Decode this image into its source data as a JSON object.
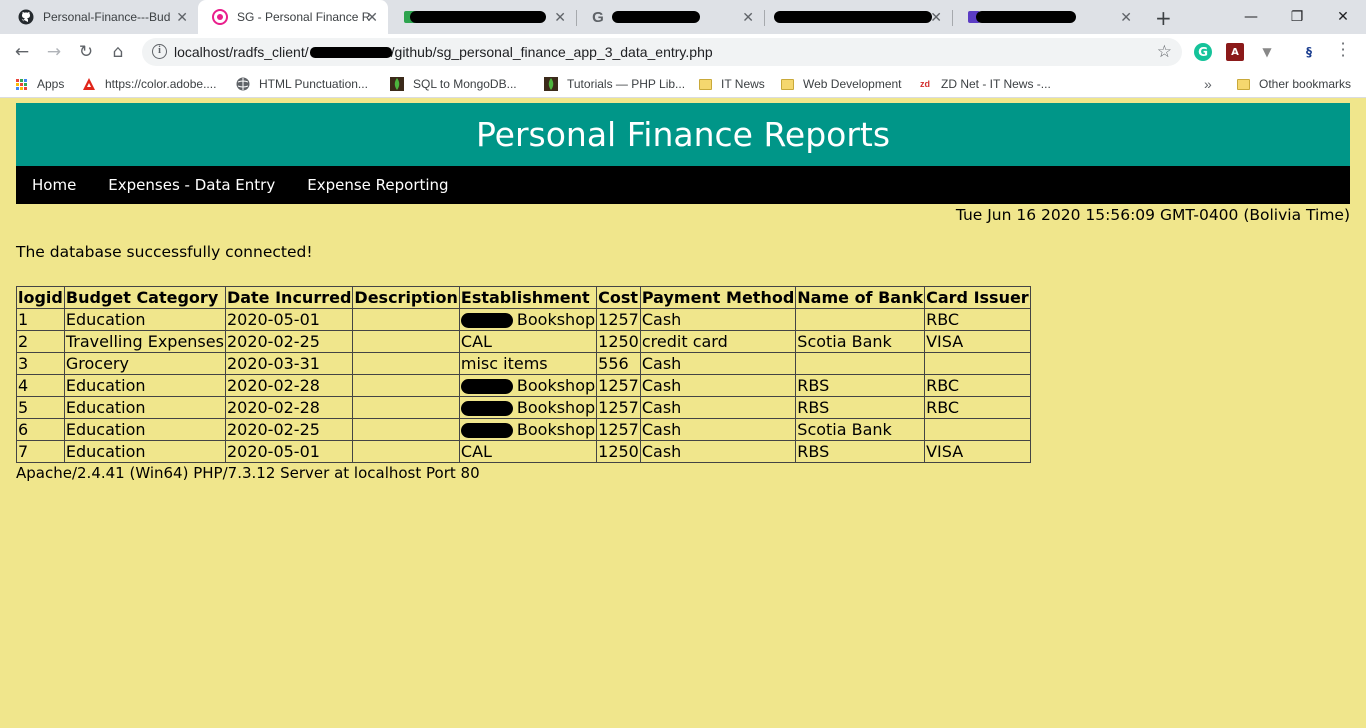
{
  "browser": {
    "tabs": [
      {
        "title": "Personal-Finance---Bud",
        "icon": "github-icon",
        "active": false
      },
      {
        "title": "SG - Personal Finance R",
        "icon": "site-icon",
        "active": true
      },
      {
        "title": "",
        "icon": "site-icon",
        "active": false
      },
      {
        "title": "",
        "icon": "google-icon",
        "active": false
      },
      {
        "title": "",
        "icon": "site-icon",
        "active": false
      },
      {
        "title": "",
        "icon": "site-icon",
        "active": false
      }
    ],
    "url_prefix": "localhost/radfs_client/",
    "url_suffix": "/github/sg_personal_finance_app_3_data_entry.php",
    "bookmarks": [
      {
        "label": "Apps",
        "icon": "apps-grid-icon"
      },
      {
        "label": "https://color.adobe....",
        "icon": "adobe-icon"
      },
      {
        "label": "HTML Punctuation...",
        "icon": "globe-icon"
      },
      {
        "label": "SQL to MongoDB...",
        "icon": "mongodb-icon"
      },
      {
        "label": "Tutorials — PHP Lib...",
        "icon": "mongodb-icon"
      },
      {
        "label": "IT News",
        "icon": "folder-icon"
      },
      {
        "label": "Web Development",
        "icon": "folder-icon"
      },
      {
        "label": "ZD Net - IT News -...",
        "icon": "zdnet-icon"
      }
    ],
    "overflow_label": "»",
    "other_bookmarks": "Other bookmarks",
    "colors": {
      "tabstrip": "#dee1e6",
      "omnibox": "#f1f3f4"
    }
  },
  "page": {
    "title": "Personal Finance Reports",
    "nav": [
      "Home",
      "Expenses - Data Entry",
      "Expense Reporting"
    ],
    "datetime": "Tue Jun 16 2020 15:56:09 GMT-0400 (Bolivia Time)",
    "status_message": "The database successfully connected!",
    "table": {
      "headers": [
        "logid",
        "Budget Category",
        "Date Incurred",
        "Description",
        "Establishment",
        "Cost",
        "Payment Method",
        "Name of Bank",
        "Card Issuer"
      ],
      "rows": [
        [
          "1",
          "Education",
          "2020-05-01",
          "",
          "Bookshop",
          "1257",
          "Cash",
          "",
          "RBC"
        ],
        [
          "2",
          "Travelling Expenses",
          "2020-02-25",
          "",
          "CAL",
          "1250",
          "credit card",
          "Scotia Bank",
          "VISA"
        ],
        [
          "3",
          "Grocery",
          "2020-03-31",
          "",
          "misc items",
          "556",
          "Cash",
          "",
          ""
        ],
        [
          "4",
          "Education",
          "2020-02-28",
          "",
          "Bookshop",
          "1257",
          "Cash",
          "RBS",
          "RBC"
        ],
        [
          "5",
          "Education",
          "2020-02-28",
          "",
          "Bookshop",
          "1257",
          "Cash",
          "RBS",
          "RBC"
        ],
        [
          "6",
          "Education",
          "2020-02-25",
          "",
          "Bookshop",
          "1257",
          "Cash",
          "Scotia Bank",
          ""
        ],
        [
          "7",
          "Education",
          "2020-05-01",
          "",
          "CAL",
          "1250",
          "Cash",
          "RBS",
          "VISA"
        ]
      ],
      "redacted_establishment_rows": [
        0,
        3,
        4,
        5
      ]
    },
    "server_signature": "Apache/2.4.41 (Win64) PHP/7.3.12 Server at localhost Port 80",
    "colors": {
      "background": "#f0e68c",
      "header": "#009688",
      "nav": "#000000"
    }
  }
}
